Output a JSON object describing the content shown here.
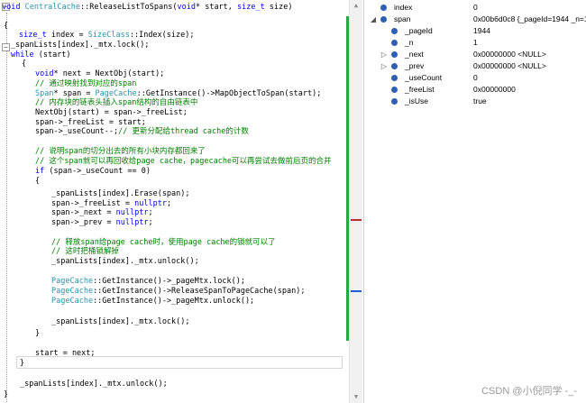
{
  "code_lines": [
    {
      "segments": [
        [
          "kw",
          "void "
        ],
        [
          "ty",
          "CentralCache"
        ],
        [
          "p",
          "::ReleaseListToSpans("
        ],
        [
          "kw",
          "void"
        ],
        [
          "p",
          "* start, "
        ],
        [
          "kw",
          "size_t"
        ],
        [
          "p",
          " size)"
        ]
      ]
    },
    {
      "segments": [
        [
          "p",
          "{"
        ]
      ]
    },
    {
      "segments": [
        [
          "kw",
          "size_t"
        ],
        [
          "p",
          " index = "
        ],
        [
          "ty",
          "SizeClass"
        ],
        [
          "p",
          "::Index(size);"
        ]
      ]
    },
    {
      "segments": [
        [
          "p",
          "_spanLists[index]._mtx.lock();"
        ]
      ]
    },
    {
      "segments": [
        [
          "kw",
          "while"
        ],
        [
          "p",
          " (start)"
        ]
      ]
    },
    {
      "segments": [
        [
          "p",
          "{"
        ]
      ]
    },
    {
      "segments": [
        [
          "kw",
          "void"
        ],
        [
          "p",
          "* next = NextObj(start);"
        ]
      ]
    },
    {
      "segments": [
        [
          "cm",
          "// 通过映射找到对应的span"
        ]
      ]
    },
    {
      "segments": [
        [
          "ty",
          "Span"
        ],
        [
          "p",
          "* span = "
        ],
        [
          "ty",
          "PageCache"
        ],
        [
          "p",
          "::GetInstance()->MapObjectToSpan(start);"
        ]
      ]
    },
    {
      "segments": [
        [
          "cm",
          "// 内存块的链表头插入span结构的自由链表中"
        ]
      ]
    },
    {
      "segments": [
        [
          "p",
          "NextObj(start) = span->_freeList;"
        ]
      ]
    },
    {
      "segments": [
        [
          "p",
          "span->_freeList = start;"
        ]
      ]
    },
    {
      "segments": [
        [
          "p",
          "span->_useCount--;"
        ],
        [
          "cm",
          "// 更新分配给thread cache的计数"
        ]
      ]
    },
    {
      "segments": [
        [
          "cm",
          "// 说明span的切分出去的所有小块内存都回来了"
        ]
      ]
    },
    {
      "segments": [
        [
          "cm",
          "// 这个span就可以再回收给page cache，pagecache可以再尝试去做前后页的合并"
        ]
      ]
    },
    {
      "segments": [
        [
          "kw",
          "if"
        ],
        [
          "p",
          " (span->_useCount == 0)"
        ]
      ]
    },
    {
      "segments": [
        [
          "p",
          "{"
        ]
      ]
    },
    {
      "segments": [
        [
          "p",
          "_spanLists[index].Erase(span);"
        ]
      ]
    },
    {
      "segments": [
        [
          "p",
          "span->_freeList = "
        ],
        [
          "kw",
          "nullptr"
        ],
        [
          "p",
          ";"
        ]
      ]
    },
    {
      "segments": [
        [
          "p",
          "span->_next = "
        ],
        [
          "kw",
          "nullptr"
        ],
        [
          "p",
          ";"
        ]
      ]
    },
    {
      "segments": [
        [
          "p",
          "span->_prev = "
        ],
        [
          "kw",
          "nullptr"
        ],
        [
          "p",
          ";"
        ]
      ]
    },
    {
      "segments": [
        [
          "cm",
          "// 释放span给page cache时，使用page cache的锁就可以了"
        ]
      ]
    },
    {
      "segments": [
        [
          "cm",
          "// 这时把桶锁解掉"
        ]
      ]
    },
    {
      "segments": [
        [
          "p",
          "_spanLists[index]._mtx.unlock();"
        ]
      ]
    },
    {
      "segments": [
        [
          "ty",
          "PageCache"
        ],
        [
          "p",
          "::GetInstance()->_pageMtx.lock();"
        ]
      ]
    },
    {
      "segments": [
        [
          "ty",
          "PageCache"
        ],
        [
          "p",
          "::GetInstance()->ReleaseSpanToPageCache(span);"
        ]
      ]
    },
    {
      "segments": [
        [
          "ty",
          "PageCache"
        ],
        [
          "p",
          "::GetInstance()->_pageMtx.unlock();"
        ]
      ]
    },
    {
      "segments": [
        [
          "p",
          "_spanLists[index]._mtx.lock();"
        ]
      ]
    },
    {
      "segments": [
        [
          "p",
          "}"
        ]
      ]
    },
    {
      "segments": [
        [
          "p",
          "start = next;"
        ]
      ]
    },
    {
      "segments": [
        [
          "p",
          "}"
        ]
      ]
    },
    {
      "segments": [
        [
          "p",
          "_spanLists[index]._mtx.unlock();"
        ]
      ]
    },
    {
      "segments": [
        [
          "p",
          "}"
        ]
      ]
    }
  ],
  "fold_toggles": [
    "−",
    "−"
  ],
  "scrollbar": {
    "up_arrow": "▲",
    "down_arrow": "▼",
    "change_color": "#28a745",
    "error_color": "#b8312f",
    "caret_color": "#1f5fd6"
  },
  "watch": {
    "rows": [
      {
        "expander": "",
        "name": "index",
        "value": "0"
      },
      {
        "expander": "◢",
        "name": "span",
        "value": "0x00b6d0c8 {_pageId=1944 _n=1 ..."
      },
      {
        "expander": "",
        "name": "_pageId",
        "value": "1944"
      },
      {
        "expander": "",
        "name": "_n",
        "value": "1"
      },
      {
        "expander": "▷",
        "name": "_next",
        "value": "0x00000000 <NULL>"
      },
      {
        "expander": "▷",
        "name": "_prev",
        "value": "0x00000000 <NULL>"
      },
      {
        "expander": "",
        "name": "_useCount",
        "value": "0"
      },
      {
        "expander": "",
        "name": "_freeList",
        "value": "0x00000000"
      },
      {
        "expander": "",
        "name": "_isUse",
        "value": "true"
      }
    ]
  },
  "colors": {
    "keyword": "#0000ff",
    "type": "#2b91af",
    "comment": "#008000"
  },
  "watermark": "CSDN @小倪同学 -_-"
}
